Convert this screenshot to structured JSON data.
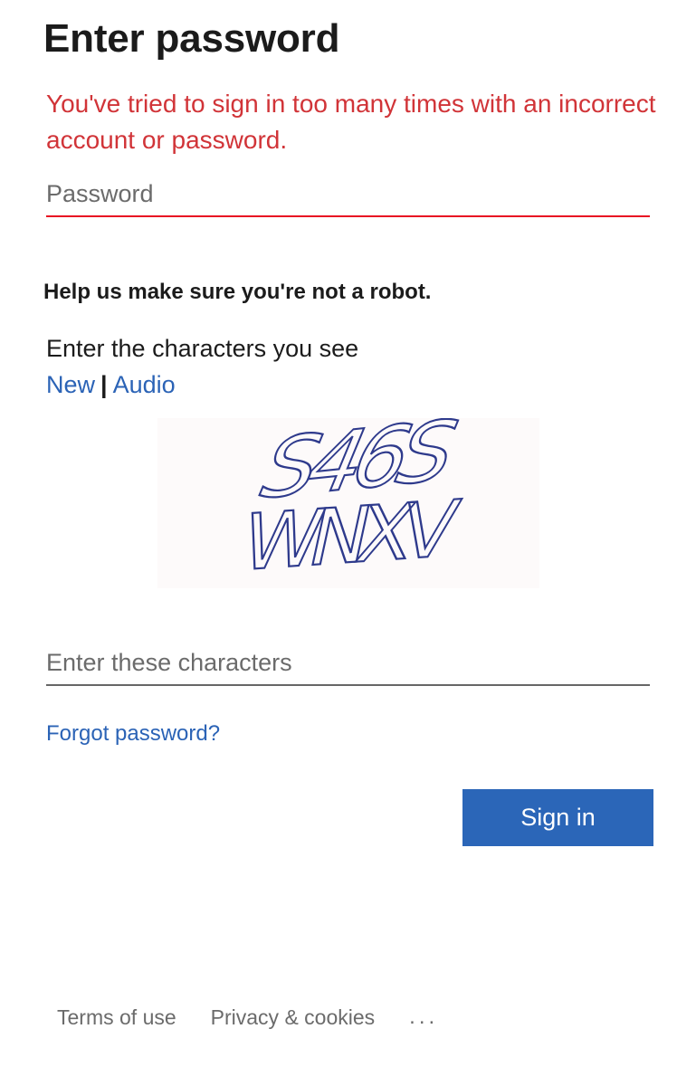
{
  "header": {
    "title": "Enter password"
  },
  "error": {
    "message": "You've tried to sign in too many times with an incorrect account or password."
  },
  "password": {
    "placeholder": "Password",
    "value": ""
  },
  "captcha": {
    "heading": "Help us make sure you're not a robot.",
    "instructions": "Enter the characters you see",
    "new_label": "New",
    "separator": "|",
    "audio_label": "Audio",
    "image_text_line1": "S46S",
    "image_text_line2": "WNXV",
    "input_placeholder": "Enter these characters"
  },
  "links": {
    "forgot_password": "Forgot password?"
  },
  "actions": {
    "sign_in_label": "Sign in"
  },
  "footer": {
    "terms": "Terms of use",
    "privacy": "Privacy & cookies",
    "more": "..."
  },
  "colors": {
    "error": "#d13438",
    "link": "#2b63b6",
    "primary_button": "#2b66b8"
  }
}
